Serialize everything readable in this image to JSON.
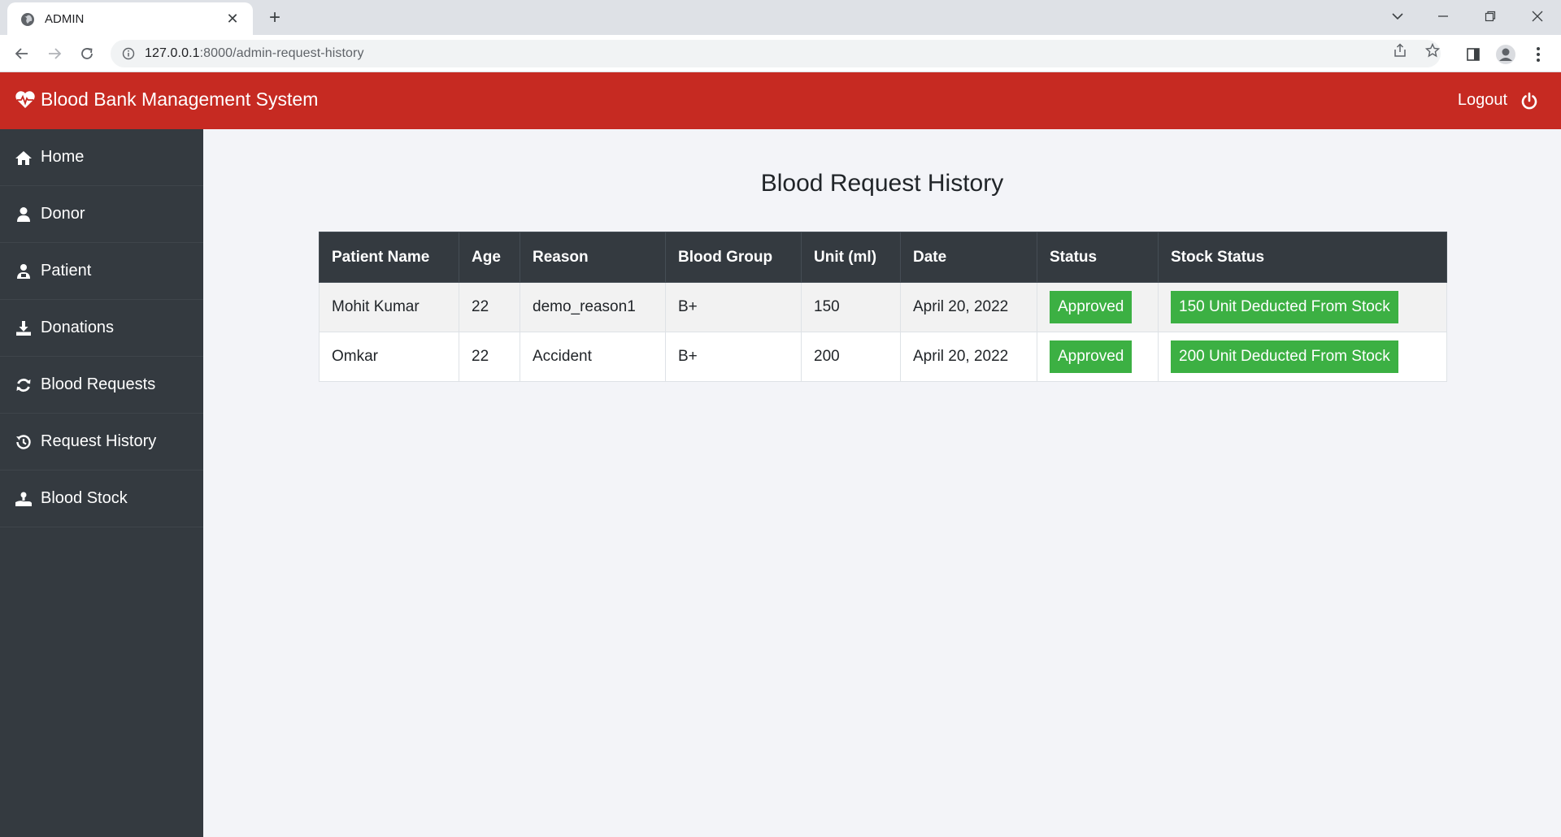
{
  "browser": {
    "tab_title": "ADMIN",
    "url_host": "127.0.0.1",
    "url_rest": ":8000/admin-request-history"
  },
  "header": {
    "brand": "Blood Bank Management System",
    "logout": "Logout"
  },
  "sidebar": {
    "items": [
      {
        "label": "Home",
        "icon": "home-icon"
      },
      {
        "label": "Donor",
        "icon": "user-icon"
      },
      {
        "label": "Patient",
        "icon": "patient-icon"
      },
      {
        "label": "Donations",
        "icon": "download-icon"
      },
      {
        "label": "Blood Requests",
        "icon": "refresh-icon"
      },
      {
        "label": "Request History",
        "icon": "history-icon"
      },
      {
        "label": "Blood Stock",
        "icon": "hand-stock-icon"
      }
    ]
  },
  "main": {
    "title": "Blood Request History",
    "columns": [
      "Patient Name",
      "Age",
      "Reason",
      "Blood Group",
      "Unit (ml)",
      "Date",
      "Status",
      "Stock Status"
    ],
    "rows": [
      {
        "patient": "Mohit Kumar",
        "age": "22",
        "reason": "demo_reason1",
        "blood_group": "B+",
        "unit": "150",
        "date": "April 20, 2022",
        "status": "Approved",
        "stock_status": "150 Unit Deducted From Stock"
      },
      {
        "patient": "Omkar",
        "age": "22",
        "reason": "Accident",
        "blood_group": "B+",
        "unit": "200",
        "date": "April 20, 2022",
        "status": "Approved",
        "stock_status": "200 Unit Deducted From Stock"
      }
    ]
  },
  "colors": {
    "header_red": "#c62a22",
    "sidebar": "#343a40",
    "badge_green": "#3cb043"
  }
}
